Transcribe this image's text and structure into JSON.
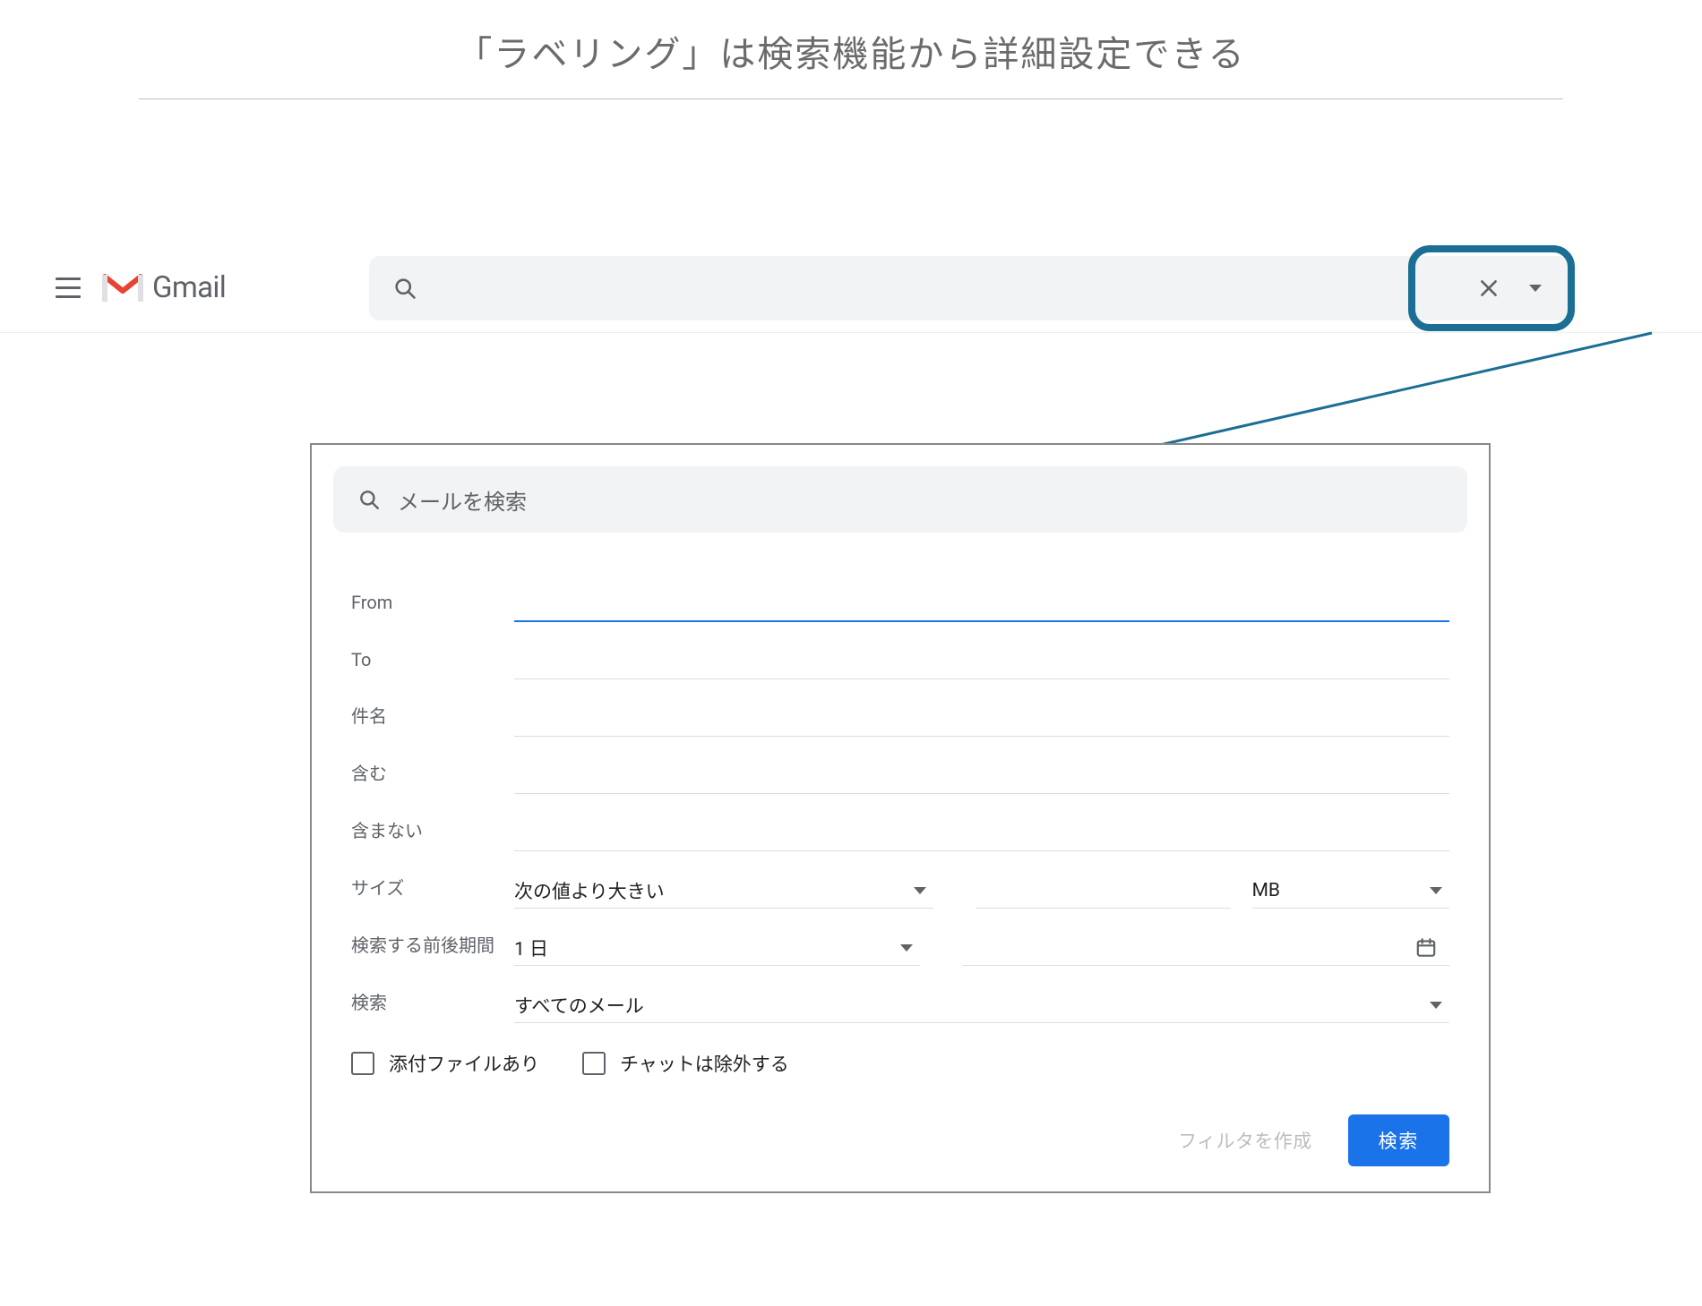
{
  "caption": "「ラベリング」は検索機能から詳細設定できる",
  "header": {
    "product_name": "Gmail",
    "search_placeholder": ""
  },
  "popup": {
    "search_placeholder": "メールを検索",
    "fields": {
      "from_label": "From",
      "to_label": "To",
      "subject_label": "件名",
      "includes_label": "含む",
      "excludes_label": "含まない",
      "size_label": "サイズ",
      "size_comparator": "次の値より大きい",
      "size_unit": "MB",
      "date_range_label": "検索する前後期間",
      "date_range_value": "1 日",
      "search_in_label": "検索",
      "search_in_value": "すべてのメール"
    },
    "checkboxes": {
      "has_attachment": "添付ファイルあり",
      "exclude_chats": "チャットは除外する"
    },
    "actions": {
      "create_filter": "フィルタを作成",
      "search": "検索"
    }
  },
  "colors": {
    "accent_blue": "#1a73e8",
    "highlight_border": "#1b6f94"
  }
}
